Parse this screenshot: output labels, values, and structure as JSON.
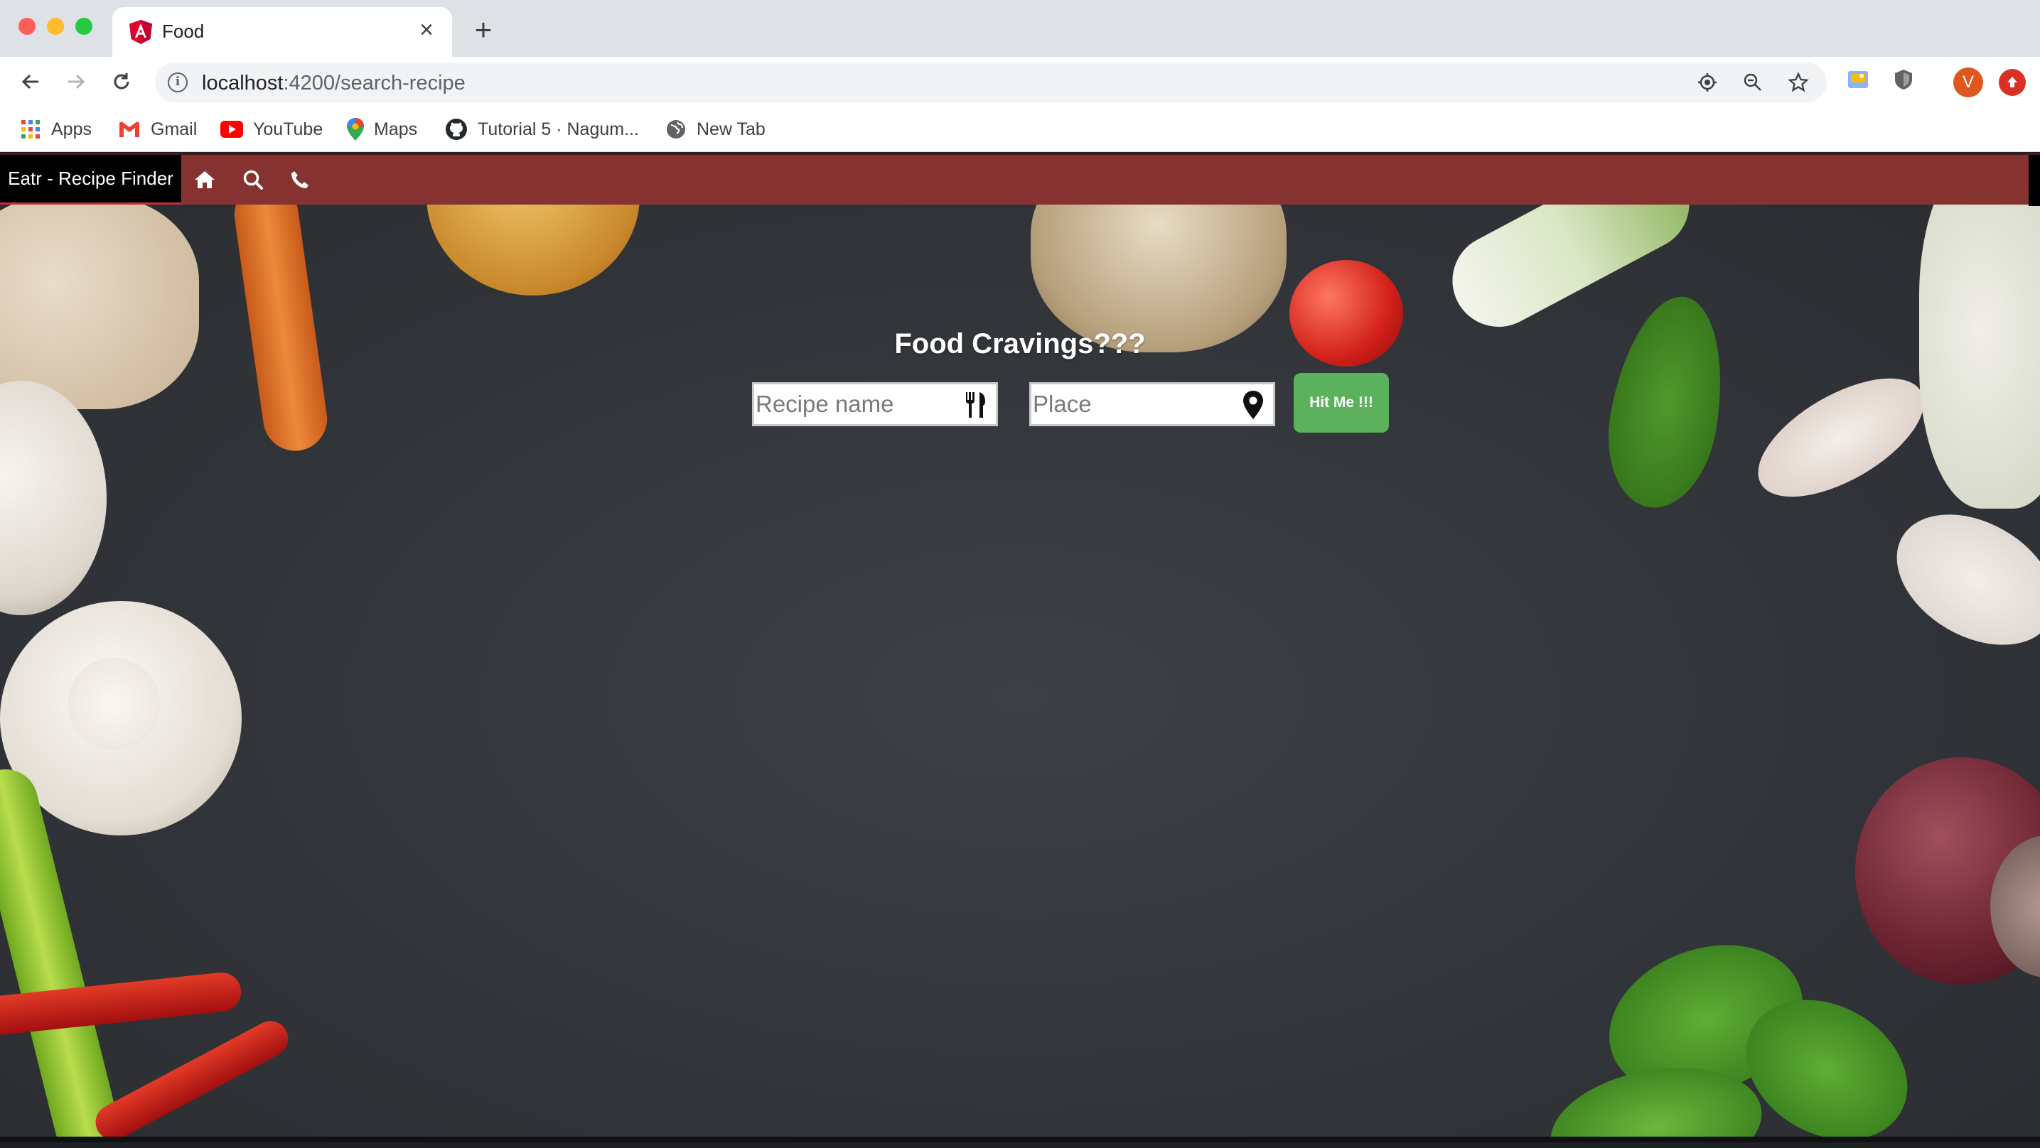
{
  "browser": {
    "tab": {
      "title": "Food",
      "favicon": "angular-icon"
    },
    "address": {
      "host": "localhost",
      "path": ":4200/search-recipe"
    },
    "bookmarks": [
      {
        "label": "Apps",
        "icon": "apps-grid-icon"
      },
      {
        "label": "Gmail",
        "icon": "gmail-icon"
      },
      {
        "label": "YouTube",
        "icon": "youtube-icon"
      },
      {
        "label": "Maps",
        "icon": "maps-icon"
      },
      {
        "label": "Tutorial 5 · Nagum...",
        "icon": "github-icon"
      },
      {
        "label": "New Tab",
        "icon": "globe-icon"
      }
    ],
    "profile_initial": "V"
  },
  "navbar": {
    "brand": "Eatr - Recipe Finder",
    "icons": [
      "home-icon",
      "search-icon",
      "phone-icon"
    ],
    "background": "#853230"
  },
  "hero": {
    "title": "Food Cravings???",
    "recipe_placeholder": "Recipe name",
    "place_placeholder": "Place",
    "button_label": "Hit Me !!!",
    "button_color": "#5cb15c"
  }
}
